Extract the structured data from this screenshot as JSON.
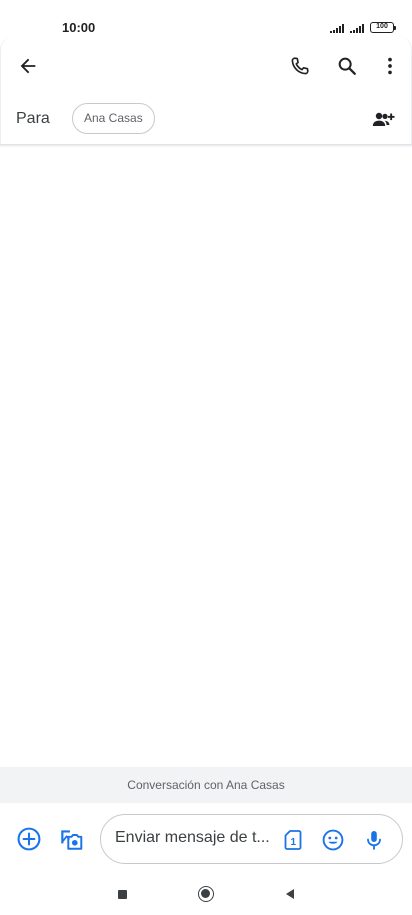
{
  "status_bar": {
    "time": "10:00",
    "battery": "100"
  },
  "header": {
    "back_icon": "arrow-back-icon",
    "actions": [
      "phone-icon",
      "search-icon",
      "more-vert-icon"
    ]
  },
  "recipients": {
    "label": "Para",
    "chips": [
      {
        "name": "Ana Casas"
      }
    ],
    "add_icon": "group-add-icon"
  },
  "conversation": {
    "banner": "Conversación con Ana Casas"
  },
  "compose": {
    "placeholder": "Enviar mensaje de t...",
    "sim_number": "1",
    "left_icons": [
      "add-circle-icon",
      "gallery-camera-icon"
    ],
    "right_icons": [
      "sim-card-icon",
      "emoji-icon",
      "mic-icon"
    ]
  },
  "nav_bar": {
    "buttons": [
      "recents-square-icon",
      "home-circle-icon",
      "back-triangle-icon"
    ]
  },
  "colors": {
    "accent": "#1a73e8",
    "icon": "#202124",
    "banner_bg": "#f1f3f4",
    "border": "#c7c9cc"
  }
}
